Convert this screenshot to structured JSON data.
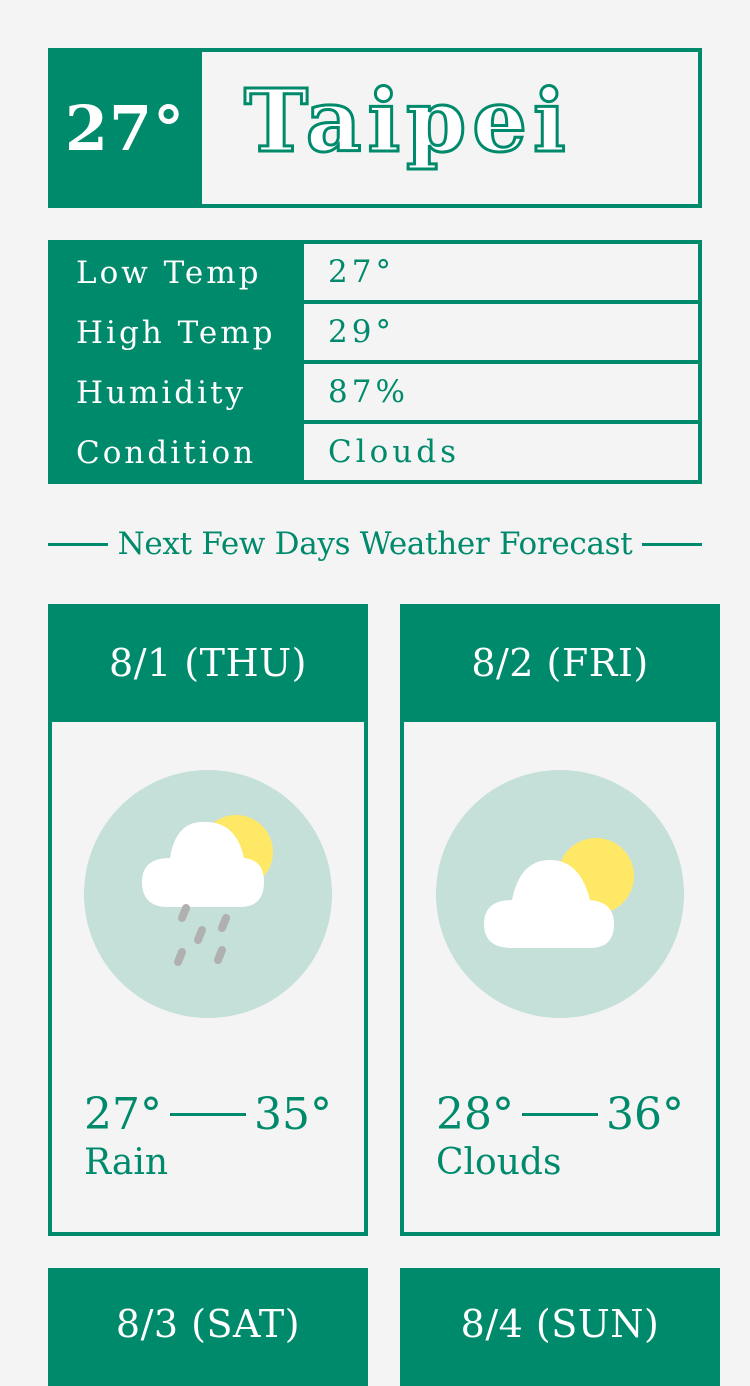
{
  "current": {
    "temp": "27°",
    "city": "Taipei"
  },
  "details": [
    {
      "label": "Low Temp",
      "value": "27°"
    },
    {
      "label": "High Temp",
      "value": "29°"
    },
    {
      "label": "Humidity",
      "value": "87%"
    },
    {
      "label": "Condition",
      "value": "Clouds"
    }
  ],
  "forecast_title": "Next Few Days Weather Forecast",
  "forecast": [
    {
      "date": "8/1 (THU)",
      "low": "27°",
      "high": "35°",
      "condition": "Rain",
      "icon": "rain-cloud-sun-icon"
    },
    {
      "date": "8/2 (FRI)",
      "low": "28°",
      "high": "36°",
      "condition": "Clouds",
      "icon": "cloud-sun-icon"
    },
    {
      "date": "8/3 (SAT)"
    },
    {
      "date": "8/4 (SUN)"
    }
  ],
  "colors": {
    "accent": "#008a6c",
    "background": "#f4f4f4",
    "icon_circle": "#c5dfd9",
    "sun": "#ffe866",
    "rain": "#b0b0b0"
  }
}
